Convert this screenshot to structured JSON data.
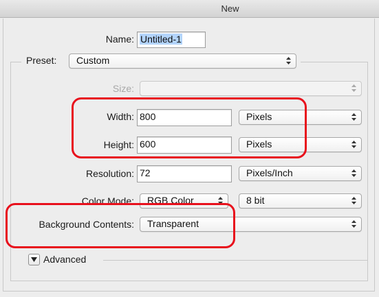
{
  "window": {
    "title": "New"
  },
  "name_field": {
    "label": "Name:",
    "value": "Untitled-1"
  },
  "preset": {
    "label": "Preset:",
    "value": "Custom"
  },
  "size": {
    "label": "Size:",
    "value": ""
  },
  "width": {
    "label": "Width:",
    "value": "800",
    "unit": "Pixels"
  },
  "height": {
    "label": "Height:",
    "value": "600",
    "unit": "Pixels"
  },
  "resolution": {
    "label": "Resolution:",
    "value": "72",
    "unit": "Pixels/Inch"
  },
  "color_mode": {
    "label": "Color Mode:",
    "value": "RGB Color",
    "depth": "8 bit"
  },
  "background": {
    "label": "Background Contents:",
    "value": "Transparent"
  },
  "advanced": {
    "label": "Advanced"
  },
  "colors": {
    "highlight": "#e8101c",
    "selection": "#b3d4fc"
  }
}
